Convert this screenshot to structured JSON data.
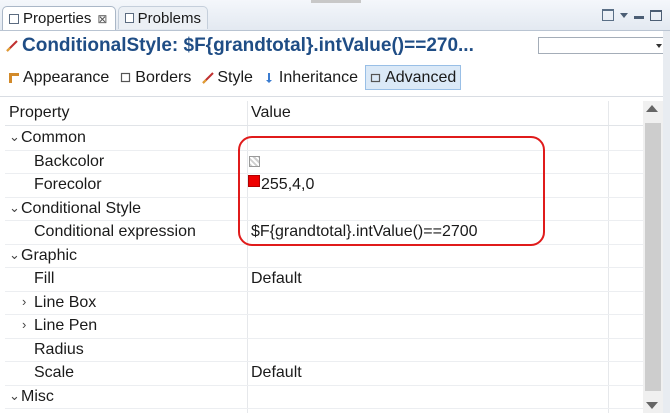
{
  "tabs": [
    {
      "label": "Properties",
      "close": "⊠"
    },
    {
      "label": "Problems"
    }
  ],
  "title": "ConditionalStyle: $F{grandtotal}.intValue()==270...",
  "combo_value": "",
  "section_tabs": [
    "Appearance",
    "Borders",
    "Style",
    "Inheritance",
    "Advanced"
  ],
  "selected_section": "Advanced",
  "table": {
    "headers": [
      "Property",
      "Value"
    ],
    "rows": [
      {
        "label": "Common",
        "value": "",
        "level": 0,
        "expander": "open"
      },
      {
        "label": "Backcolor",
        "value": "",
        "level": 1,
        "swatch": "empty"
      },
      {
        "label": "Forecolor",
        "value": "255,4,0",
        "level": 1,
        "swatch": "red"
      },
      {
        "label": "Conditional Style",
        "value": "",
        "level": 0,
        "expander": "open"
      },
      {
        "label": "Conditional expression",
        "value": "$F{grandtotal}.intValue()==2700",
        "level": 1
      },
      {
        "label": "Graphic",
        "value": "",
        "level": 0,
        "expander": "open"
      },
      {
        "label": "Fill",
        "value": "Default",
        "level": 1
      },
      {
        "label": "Line Box",
        "value": "",
        "level": 1,
        "expander": "closed"
      },
      {
        "label": "Line Pen",
        "value": "",
        "level": 1,
        "expander": "closed"
      },
      {
        "label": "Radius",
        "value": "",
        "level": 1
      },
      {
        "label": "Scale",
        "value": "Default",
        "level": 1
      },
      {
        "label": "Misc",
        "value": "",
        "level": 0,
        "expander": "open"
      }
    ]
  },
  "colors": {
    "title": "#1f4d85",
    "highlight": "#e01b1b",
    "forecolor": "#ff0400"
  }
}
